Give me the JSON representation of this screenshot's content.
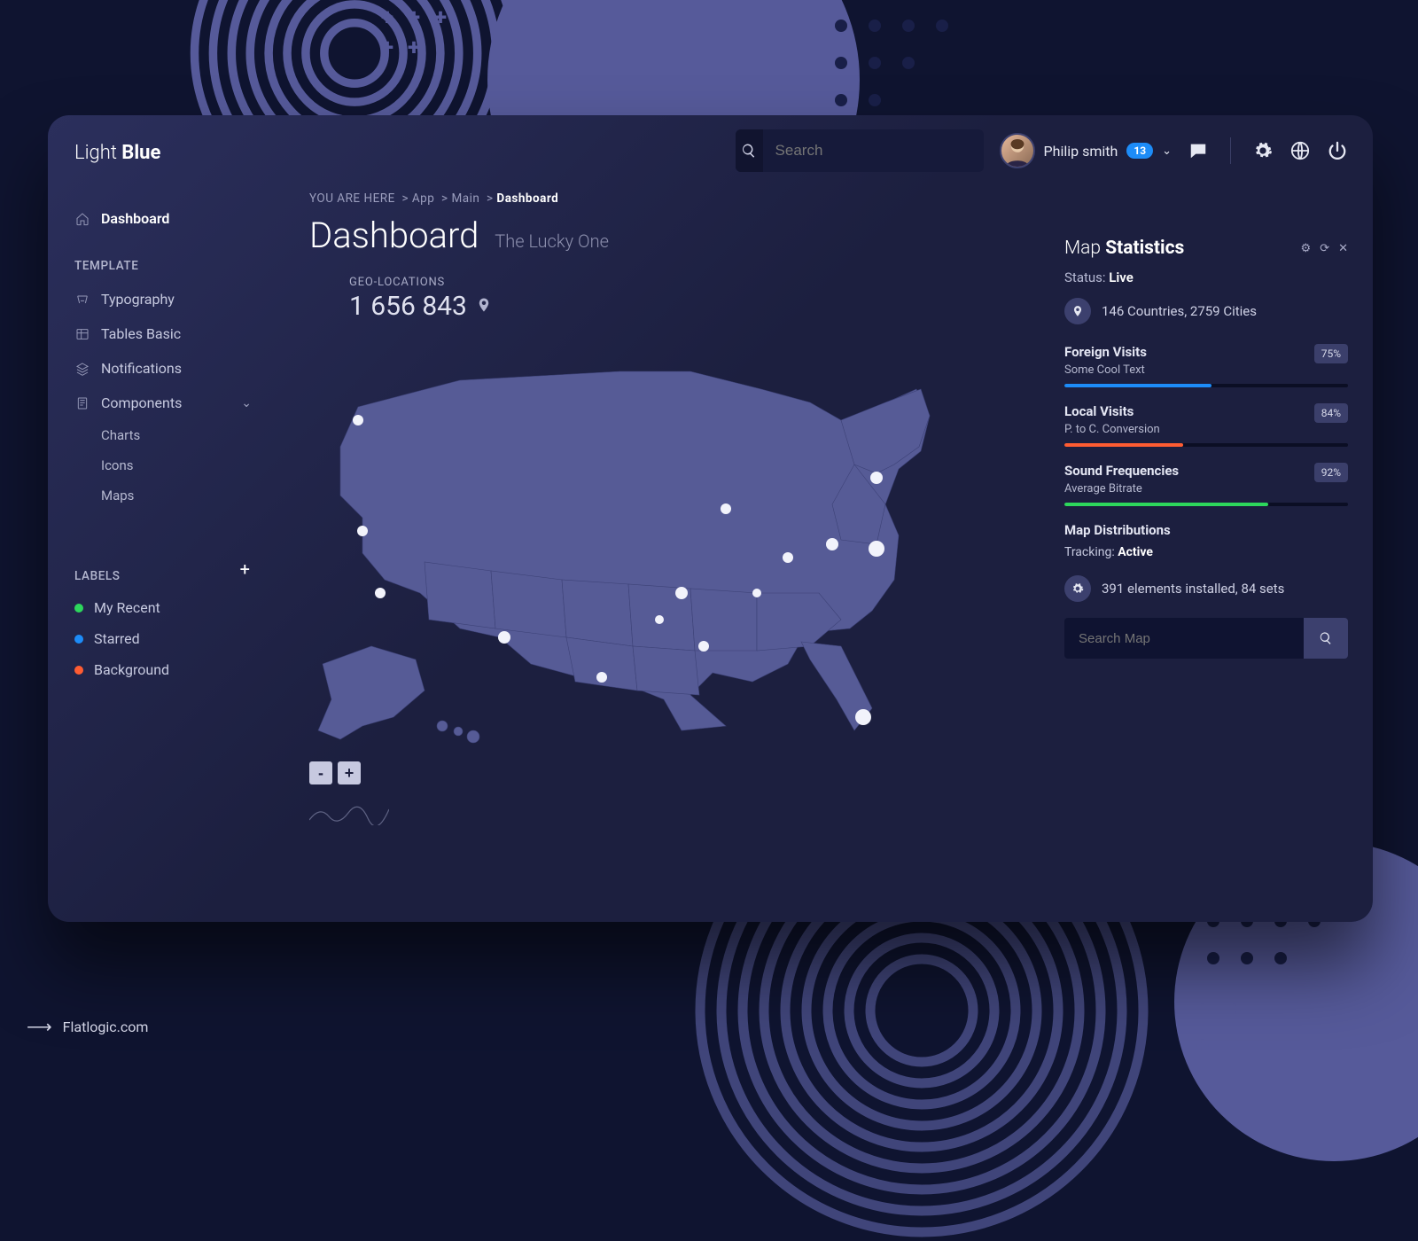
{
  "logo": {
    "a": "Light",
    "b": "Blue"
  },
  "search": {
    "placeholder": "Search"
  },
  "user": {
    "name": "Philip smith",
    "badge": "13"
  },
  "sidebar": {
    "dashboard": "Dashboard",
    "templateHeading": "TEMPLATE",
    "items": [
      {
        "label": "Typography"
      },
      {
        "label": "Tables Basic"
      },
      {
        "label": "Notifications"
      },
      {
        "label": "Components"
      }
    ],
    "subitems": [
      {
        "label": "Charts"
      },
      {
        "label": "Icons"
      },
      {
        "label": "Maps"
      }
    ],
    "labelsHeading": "LABELS",
    "labels": [
      {
        "label": "My Recent",
        "color": "#2dd75c"
      },
      {
        "label": "Starred",
        "color": "#1d8cf8"
      },
      {
        "label": "Background",
        "color": "#ff5c32"
      }
    ]
  },
  "breadcrumb": {
    "lead": "YOU ARE HERE",
    "a": "App",
    "b": "Main",
    "c": "Dashboard"
  },
  "page": {
    "title": "Dashboard",
    "subtitle": "The Lucky One"
  },
  "geo": {
    "label": "GEO-LOCATIONS",
    "count": "1 656 843"
  },
  "zoom": {
    "minus": "-",
    "plus": "+"
  },
  "widget": {
    "title_a": "Map",
    "title_b": "Statistics",
    "statusLabel": "Status:",
    "statusValue": "Live",
    "locationLine": "146 Countries, 2759 Cities",
    "stats": [
      {
        "title": "Foreign Visits",
        "sub": "Some Cool Text",
        "pct": "75%",
        "pctNum": 52,
        "color": "#1d8cf8"
      },
      {
        "title": "Local Visits",
        "sub": "P. to C. Conversion",
        "pct": "84%",
        "pctNum": 42,
        "color": "#ff5c32"
      },
      {
        "title": "Sound Frequencies",
        "sub": "Average Bitrate",
        "pct": "92%",
        "pctNum": 72,
        "color": "#2dd75c"
      }
    ],
    "dist": {
      "title": "Map Distributions",
      "trackLabel": "Tracking:",
      "trackValue": "Active"
    },
    "installed": "391 elements installed, 84 sets",
    "mapSearch": {
      "placeholder": "Search Map"
    }
  },
  "credit": "Flatlogic.com"
}
